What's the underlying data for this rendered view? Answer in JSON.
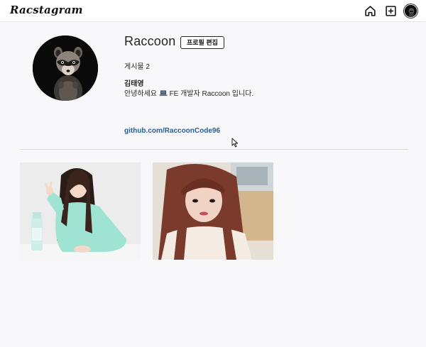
{
  "nav": {
    "logo": "Racstagram",
    "home_icon": "home-icon",
    "add_icon": "add-post-icon",
    "profile_icon": "avatar"
  },
  "profile": {
    "username": "Raccoon",
    "edit_label": "프로필 편집",
    "posts_label": "게시물",
    "posts_count": "2",
    "name": "김태영",
    "bio_prefix": "안녕하세요",
    "bio_icon": "laptop-icon",
    "bio_suffix": "FE 개발자 Raccoon 입니다.",
    "link": "github.com/RaccoonCode96"
  },
  "posts": [
    {
      "id": "post-1",
      "thumbnail": "photo"
    },
    {
      "id": "post-2",
      "thumbnail": "photo"
    }
  ],
  "colors": {
    "background": "#f8f7fa",
    "link": "#2a5e8f",
    "text": "#262626"
  }
}
